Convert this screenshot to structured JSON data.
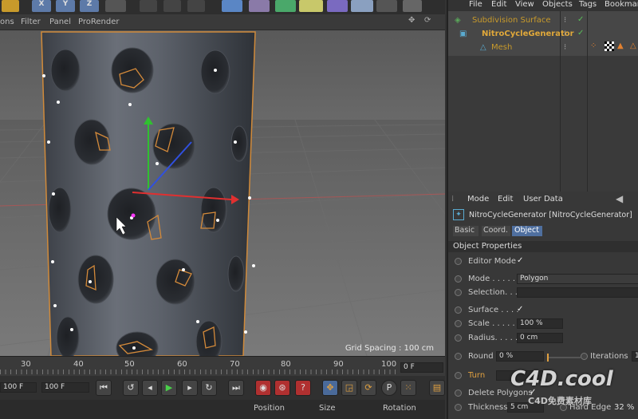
{
  "toolbar": {
    "labels": [
      "X",
      "Y",
      "Z"
    ]
  },
  "viewport": {
    "menu": [
      "ons",
      "Filter",
      "Panel",
      "ProRender"
    ],
    "grid_spacing": "Grid Spacing : 100 cm"
  },
  "timeline": {
    "ticks": [
      "30",
      "40",
      "50",
      "60",
      "70",
      "80",
      "90",
      "100"
    ],
    "frame": "0 F"
  },
  "transport": {
    "min_field": "100 F",
    "max_field": "100 F"
  },
  "coords": {
    "position": "Position",
    "size": "Size",
    "rotation": "Rotation"
  },
  "object_manager": {
    "menu": [
      "File",
      "Edit",
      "View",
      "Objects",
      "Tags",
      "Bookmar"
    ],
    "items": [
      {
        "name": "Subdivision Surface",
        "icon": "subdivision-surface-icon",
        "color": "#d4a43a"
      },
      {
        "name": "NitroCycleGenerator",
        "icon": "plugin-generator-icon",
        "color": "#e0a83a"
      },
      {
        "name": "Mesh",
        "icon": "polygon-object-icon",
        "color": "#c88a2e"
      }
    ]
  },
  "attributes": {
    "menu": [
      "Mode",
      "Edit",
      "User Data"
    ],
    "object_title": "NitroCycleGenerator [NitroCycleGenerator]",
    "tabs": [
      "Basic",
      "Coord.",
      "Object"
    ],
    "section": "Object Properties",
    "editor_mode": {
      "label": "Editor Mode",
      "value": "✓"
    },
    "mode": {
      "label": "Mode . . . . .",
      "value": "Polygon"
    },
    "selection": {
      "label": "Selection. . ."
    },
    "surface": {
      "label": "Surface . . . .",
      "value": "✓"
    },
    "scale": {
      "label": "Scale . . . . . .",
      "value": "100 %"
    },
    "radius": {
      "label": "Radius. . . . .",
      "value": "0 cm"
    },
    "round": {
      "label": "Round",
      "value": "0 %"
    },
    "iterations": {
      "label": "Iterations",
      "value": "1"
    },
    "turn": {
      "label": "Turn"
    },
    "delete_polygons": {
      "label": "Delete Polygons",
      "value": "✓"
    },
    "thickness": {
      "label": "Thickness",
      "value": "5 cm"
    },
    "hard_edge": {
      "label": "Hard Edge",
      "value": "32 %"
    }
  },
  "watermark": {
    "main": "C4D.cool",
    "sub": "C4D免费素材库"
  }
}
